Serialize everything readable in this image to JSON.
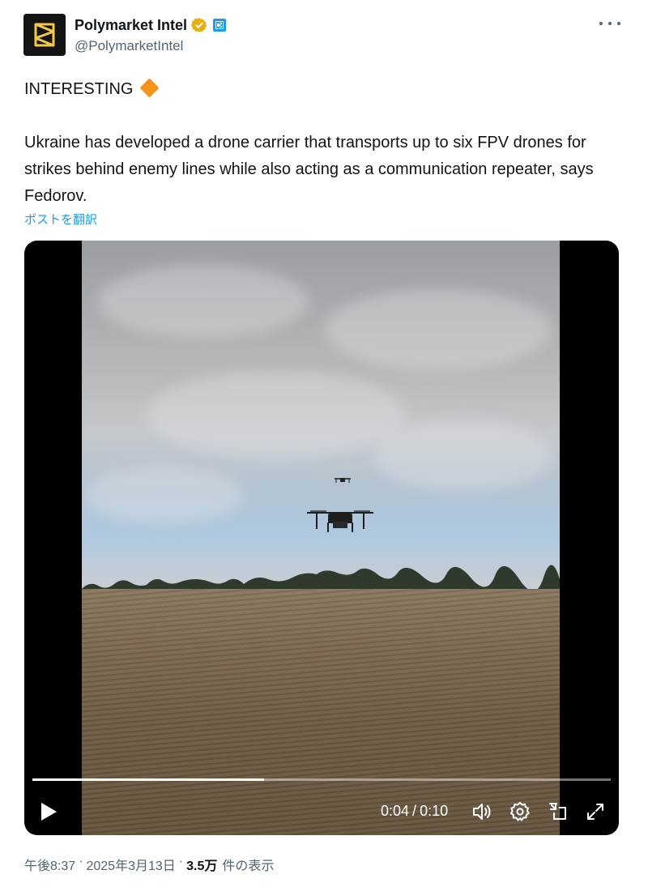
{
  "author": {
    "display_name": "Polymarket Intel",
    "handle": "@PolymarketIntel",
    "verified_color": "#e8b00e",
    "affiliate_color": "#1d9bf0"
  },
  "post": {
    "headline": "INTERESTING",
    "headline_emoji": "orange-diamond",
    "body": "Ukraine has developed a drone carrier that transports up to six FPV drones for strikes behind enemy lines while also acting as a communication repeater, says Fedorov.",
    "translate_label": "ポストを翻訳"
  },
  "video": {
    "current_time": "0:04",
    "separator": "/",
    "duration": "0:10",
    "progress_fraction": 0.4,
    "controls": [
      "play-icon",
      "volume-icon",
      "settings-icon",
      "picture-in-picture-icon",
      "fullscreen-icon"
    ]
  },
  "meta": {
    "time": "午後8:37",
    "dot1": "·",
    "date": "2025年3月13日",
    "dot2": "·",
    "views_count": "3.5万",
    "views_label": "件の表示"
  },
  "colors": {
    "text_primary": "#0f1419",
    "text_secondary": "#536471",
    "link": "#1d9bf0",
    "accent_diamond": "#f7931a"
  }
}
